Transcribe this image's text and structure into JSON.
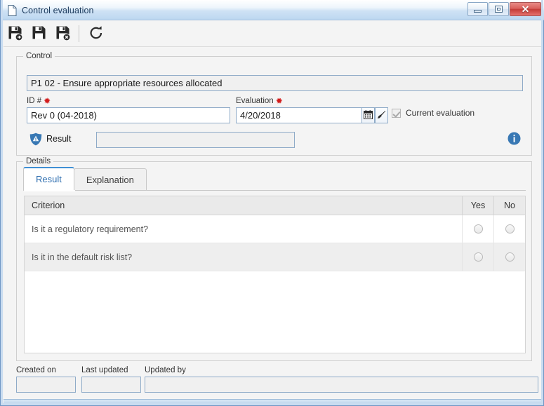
{
  "window": {
    "title": "Control evaluation",
    "doc_icon": "document-icon",
    "minimize_label": "",
    "restore_label": "",
    "close_label": "✕"
  },
  "toolbar": {
    "buttons": [
      {
        "name": "save-and-new-button",
        "icon": "save-add-icon",
        "tooltip": "Save and new"
      },
      {
        "name": "save-button",
        "icon": "save-icon",
        "tooltip": "Save"
      },
      {
        "name": "save-and-close-button",
        "icon": "save-close-icon",
        "tooltip": "Save and close"
      },
      {
        "name": "refresh-button",
        "icon": "refresh-icon",
        "tooltip": "Refresh"
      }
    ]
  },
  "control_group": {
    "legend": "Control",
    "control_field": {
      "label": "Control",
      "value": "P1 02 - Ensure appropriate resources allocated",
      "placeholder": ""
    },
    "id_field": {
      "label": "ID #",
      "required_mark": "✹",
      "value": "Rev 0 (04-2018)",
      "placeholder": ""
    },
    "evaluation_field": {
      "label": "Evaluation",
      "required_mark": "✹",
      "value": "4/20/2018",
      "placeholder": ""
    },
    "calendar_button": {
      "icon": "calendar-icon"
    },
    "brush_button": {
      "icon": "brush-icon"
    },
    "current_evaluation": {
      "label": "Current evaluation",
      "checked": true,
      "enabled": false
    },
    "result": {
      "icon": "shield-warning-icon",
      "label": "Result",
      "value": "",
      "placeholder": ""
    },
    "info_button": {
      "icon": "info-icon"
    }
  },
  "details_group": {
    "legend": "Details",
    "tabs": [
      {
        "label": "Result",
        "active": true
      },
      {
        "label": "Explanation",
        "active": false
      }
    ],
    "grid": {
      "columns": [
        "Criterion",
        "Yes",
        "No"
      ],
      "rows": [
        {
          "criterion": "Is it a regulatory requirement?",
          "yes": false,
          "no": false
        },
        {
          "criterion": "Is it in the default risk list?",
          "yes": false,
          "no": false
        }
      ]
    }
  },
  "footer": {
    "created_on": {
      "label": "Created on",
      "value": ""
    },
    "last_updated": {
      "label": "Last updated",
      "value": ""
    },
    "updated_by": {
      "label": "Updated by",
      "value": ""
    }
  },
  "colors": {
    "accent": "#3f8fd4",
    "required": "#d21c1c",
    "titlebar": "#bcd7f0",
    "panel": "#f4f4f4",
    "close_button": "#c33c37"
  }
}
